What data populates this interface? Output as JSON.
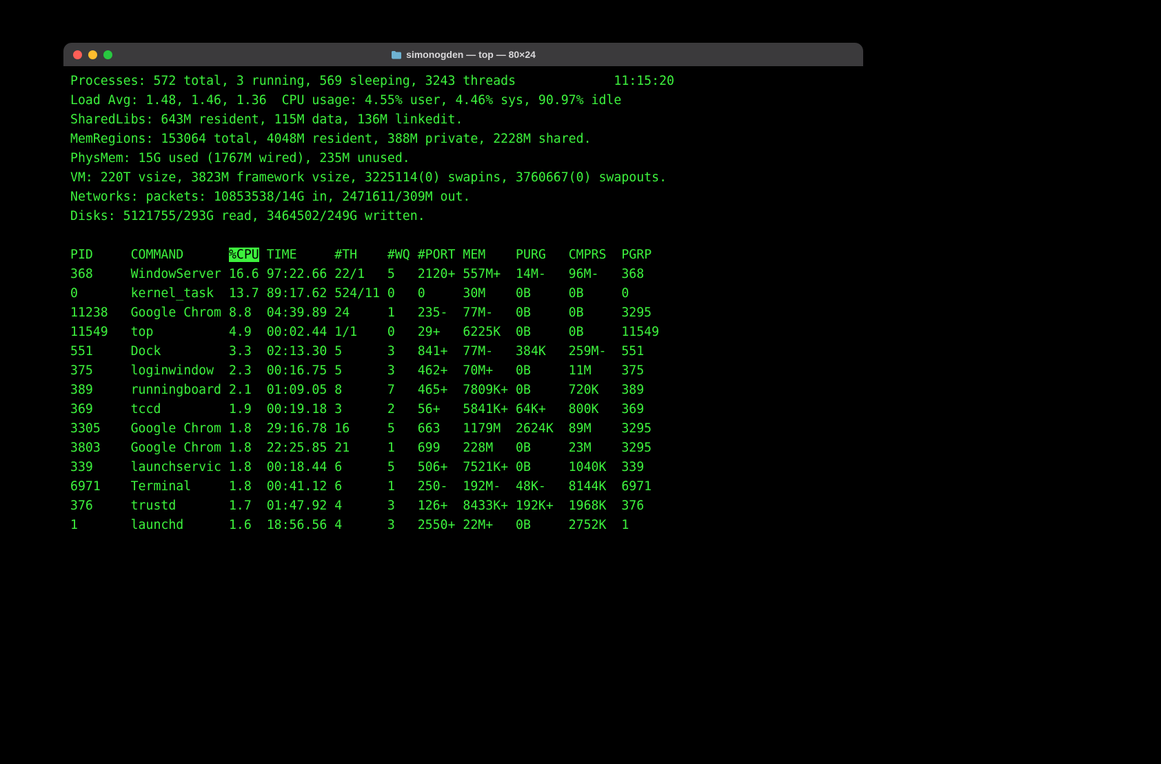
{
  "window": {
    "title": "simonogden — top — 80×24"
  },
  "summary": {
    "line1_left": "Processes: 572 total, 3 running, 569 sleeping, 3243 threads",
    "time": "11:15:20",
    "line2": "Load Avg: 1.48, 1.46, 1.36  CPU usage: 4.55% user, 4.46% sys, 90.97% idle",
    "line3": "SharedLibs: 643M resident, 115M data, 136M linkedit.",
    "line4": "MemRegions: 153064 total, 4048M resident, 388M private, 2228M shared.",
    "line5": "PhysMem: 15G used (1767M wired), 235M unused.",
    "line6": "VM: 220T vsize, 3823M framework vsize, 3225114(0) swapins, 3760667(0) swapouts.",
    "line7": "Networks: packets: 10853538/14G in, 2471611/309M out.",
    "line8": "Disks: 5121755/293G read, 3464502/249G written."
  },
  "header": {
    "pid": "PID",
    "command": "COMMAND",
    "cpu": "%CPU",
    "time": "TIME",
    "th": "#TH",
    "wq": "#WQ",
    "port": "#PORT",
    "mem": "MEM",
    "purg": "PURG",
    "cmprs": "CMPRS",
    "pgrp": "PGRP"
  },
  "rows": [
    {
      "pid": "368",
      "command": "WindowServer",
      "cpu": "16.6",
      "time": "97:22.66",
      "th": "22/1",
      "wq": "5",
      "port": "2120+",
      "mem": "557M+",
      "purg": "14M-",
      "cmprs": "96M-",
      "pgrp": "368"
    },
    {
      "pid": "0",
      "command": "kernel_task",
      "cpu": "13.7",
      "time": "89:17.62",
      "th": "524/11",
      "wq": "0",
      "port": "0",
      "mem": "30M",
      "purg": "0B",
      "cmprs": "0B",
      "pgrp": "0"
    },
    {
      "pid": "11238",
      "command": "Google Chrom",
      "cpu": "8.8",
      "time": "04:39.89",
      "th": "24",
      "wq": "1",
      "port": "235-",
      "mem": "77M-",
      "purg": "0B",
      "cmprs": "0B",
      "pgrp": "3295"
    },
    {
      "pid": "11549",
      "command": "top",
      "cpu": "4.9",
      "time": "00:02.44",
      "th": "1/1",
      "wq": "0",
      "port": "29+",
      "mem": "6225K",
      "purg": "0B",
      "cmprs": "0B",
      "pgrp": "11549"
    },
    {
      "pid": "551",
      "command": "Dock",
      "cpu": "3.3",
      "time": "02:13.30",
      "th": "5",
      "wq": "3",
      "port": "841+",
      "mem": "77M-",
      "purg": "384K",
      "cmprs": "259M-",
      "pgrp": "551"
    },
    {
      "pid": "375",
      "command": "loginwindow",
      "cpu": "2.3",
      "time": "00:16.75",
      "th": "5",
      "wq": "3",
      "port": "462+",
      "mem": "70M+",
      "purg": "0B",
      "cmprs": "11M",
      "pgrp": "375"
    },
    {
      "pid": "389",
      "command": "runningboard",
      "cpu": "2.1",
      "time": "01:09.05",
      "th": "8",
      "wq": "7",
      "port": "465+",
      "mem": "7809K+",
      "purg": "0B",
      "cmprs": "720K",
      "pgrp": "389"
    },
    {
      "pid": "369",
      "command": "tccd",
      "cpu": "1.9",
      "time": "00:19.18",
      "th": "3",
      "wq": "2",
      "port": "56+",
      "mem": "5841K+",
      "purg": "64K+",
      "cmprs": "800K",
      "pgrp": "369"
    },
    {
      "pid": "3305",
      "command": "Google Chrom",
      "cpu": "1.8",
      "time": "29:16.78",
      "th": "16",
      "wq": "5",
      "port": "663",
      "mem": "1179M",
      "purg": "2624K",
      "cmprs": "89M",
      "pgrp": "3295"
    },
    {
      "pid": "3803",
      "command": "Google Chrom",
      "cpu": "1.8",
      "time": "22:25.85",
      "th": "21",
      "wq": "1",
      "port": "699",
      "mem": "228M",
      "purg": "0B",
      "cmprs": "23M",
      "pgrp": "3295"
    },
    {
      "pid": "339",
      "command": "launchservic",
      "cpu": "1.8",
      "time": "00:18.44",
      "th": "6",
      "wq": "5",
      "port": "506+",
      "mem": "7521K+",
      "purg": "0B",
      "cmprs": "1040K",
      "pgrp": "339"
    },
    {
      "pid": "6971",
      "command": "Terminal",
      "cpu": "1.8",
      "time": "00:41.12",
      "th": "6",
      "wq": "1",
      "port": "250-",
      "mem": "192M-",
      "purg": "48K-",
      "cmprs": "8144K",
      "pgrp": "6971"
    },
    {
      "pid": "376",
      "command": "trustd",
      "cpu": "1.7",
      "time": "01:47.92",
      "th": "4",
      "wq": "3",
      "port": "126+",
      "mem": "8433K+",
      "purg": "192K+",
      "cmprs": "1968K",
      "pgrp": "376"
    },
    {
      "pid": "1",
      "command": "launchd",
      "cpu": "1.6",
      "time": "18:56.56",
      "th": "4",
      "wq": "3",
      "port": "2550+",
      "mem": "22M+",
      "purg": "0B",
      "cmprs": "2752K",
      "pgrp": "1"
    }
  ],
  "widths": {
    "pid": 8,
    "command": 13,
    "cpu": 5,
    "time": 9,
    "th": 7,
    "wq": 4,
    "port": 6,
    "mem": 7,
    "purg": 7,
    "cmprs": 7,
    "pgrp": 6
  }
}
